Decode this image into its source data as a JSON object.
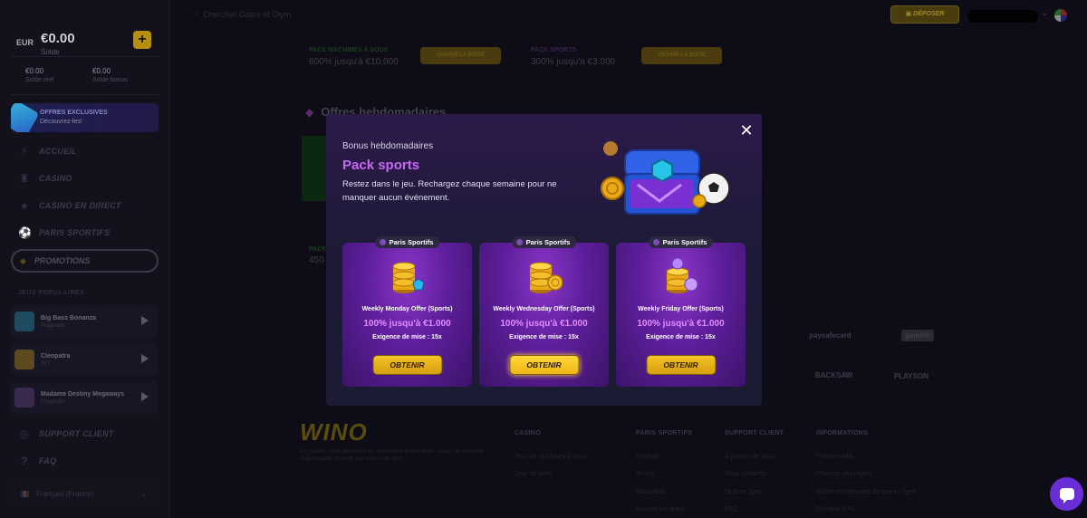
{
  "sidebar": {
    "currency": "EUR",
    "balance": "€0.00",
    "balance_label": "Solde",
    "mini": [
      {
        "value": "€0.00",
        "label": "Solde réel"
      },
      {
        "value": "€0.00",
        "label": "Solde bonus"
      }
    ],
    "offers": {
      "title": "OFFRES EXCLUSIVES",
      "subtitle": "Découvrez-les!"
    },
    "nav": [
      {
        "label": "ACCUEIL",
        "icon": "bolt-icon"
      },
      {
        "label": "CASINO",
        "icon": "slot-icon"
      },
      {
        "label": "CASINO EN DIRECT",
        "icon": "cards-icon"
      },
      {
        "label": "PARIS SPORTIFS",
        "icon": "ball-icon"
      }
    ],
    "promotions": "PROMOTIONS",
    "popular_label": "JEUX POPULAIRES",
    "games": [
      {
        "name": "Big Bass Bonanza",
        "provider": "Pragmatic"
      },
      {
        "name": "Cleopatra",
        "provider": "IGT"
      },
      {
        "name": "Madame Destiny Megaways",
        "provider": "Pragmatic"
      }
    ],
    "bottom_nav": [
      {
        "label": "SUPPORT CLIENT"
      },
      {
        "label": "FAQ"
      }
    ],
    "language": "Français (France)"
  },
  "topbar": {
    "search_placeholder": "Chercher Gates of Olym",
    "deposit": "DÉPOSER"
  },
  "background": {
    "pack1_title": "PACK MACHINES À SOUS",
    "pack1_offer": "600% jusqu'à €10.000",
    "pack2_title": "PACK SPORTS",
    "pack2_offer": "300% jusqu'à €3.000",
    "open_box": "OUVRIR LA BOITE",
    "weekly_title": "Offres hebdomadaires",
    "pack3_title": "PACK",
    "pack3_offer": "450",
    "brands": [
      "paysafecard",
      "gamble",
      "BACKSAW",
      "PLAYSON"
    ],
    "footer_logo": "WINO",
    "footer_desc": "En jouant, vous acceptez les conditions d'utilisation. Jouez de manière responsable. Interdit aux moins de 18+.",
    "footer_cols": [
      {
        "title": "CASINO",
        "items": [
          "Jeux de machines à sous",
          "Jeux de table"
        ]
      },
      {
        "title": "PARIS SPORTIFS",
        "items": [
          "Football",
          "Tennis",
          "Basketball",
          "Hockey sur glace"
        ]
      },
      {
        "title": "SUPPORT CLIENT",
        "items": [
          "À propos de nous",
          "Nous contacter",
          "Droit en ligne",
          "FAQ"
        ]
      },
      {
        "title": "INFORMATIONS",
        "items": [
          "Politique AML",
          "Politique des règles",
          "Sports et méthodes de pari en ligne",
          "Politique KYC"
        ]
      }
    ]
  },
  "modal": {
    "subtitle": "Bonus hebdomadaires",
    "title": "Pack sports",
    "description": "Restez dans le jeu. Rechargez chaque semaine pour ne manquer aucun événement.",
    "cards": [
      {
        "tag": "Paris Sportifs",
        "name": "Weekly Monday Offer (Sports)",
        "amount": "100% jusqu'à €1.000",
        "requirement": "Exigence de mise : 15x",
        "button": "OBTENIR"
      },
      {
        "tag": "Paris Sportifs",
        "name": "Weekly Wednesday Offer (Sports)",
        "amount": "100% jusqu'à €1.000",
        "requirement": "Exigence de mise : 15x",
        "button": "OBTENIR"
      },
      {
        "tag": "Paris Sportifs",
        "name": "Weekly Friday Offer (Sports)",
        "amount": "100% jusqu'à €1.000",
        "requirement": "Exigence de mise : 15x",
        "button": "OBTENIR"
      }
    ]
  }
}
